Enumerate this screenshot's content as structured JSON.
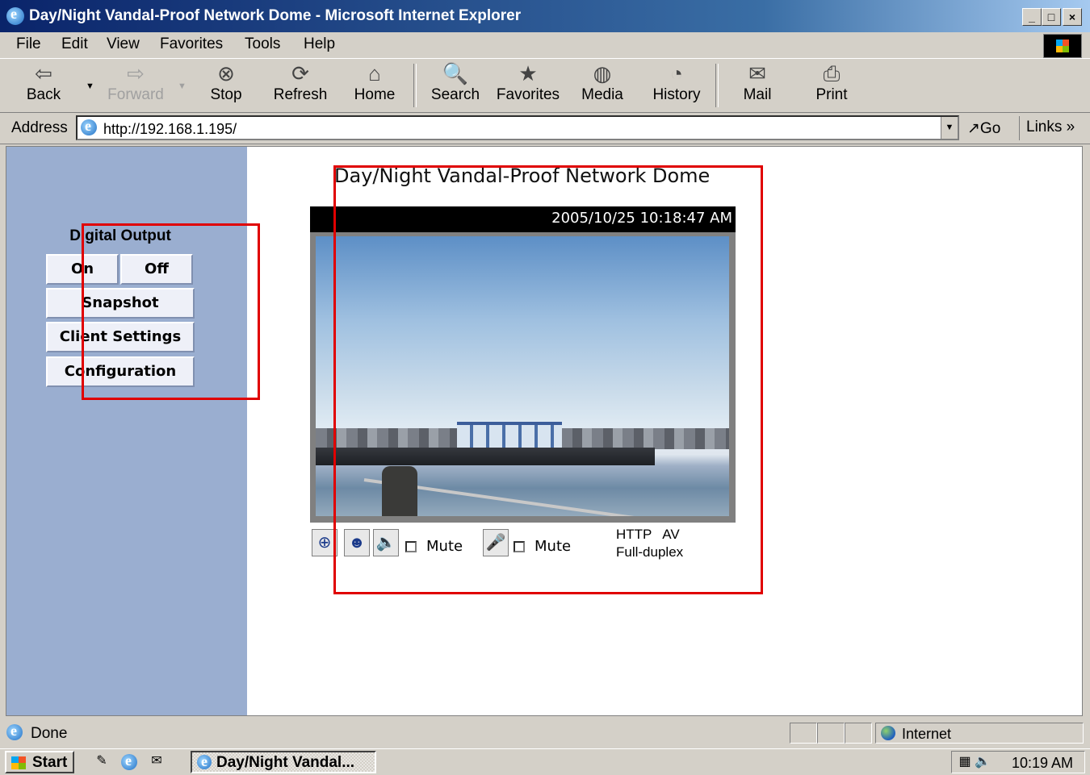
{
  "window": {
    "title": "Day/Night Vandal-Proof Network Dome - Microsoft Internet Explorer",
    "controls": {
      "minimize": "_",
      "maximize": "□",
      "close": "×"
    }
  },
  "menubar": {
    "items": [
      {
        "label": "File",
        "accel": "F"
      },
      {
        "label": "Edit",
        "accel": "E"
      },
      {
        "label": "View",
        "accel": "V"
      },
      {
        "label": "Favorites",
        "accel": "a"
      },
      {
        "label": "Tools",
        "accel": "T"
      },
      {
        "label": "Help",
        "accel": "H"
      }
    ]
  },
  "toolbar": {
    "back": "Back",
    "forward": "Forward",
    "stop": "Stop",
    "refresh": "Refresh",
    "home": "Home",
    "search": "Search",
    "favorites": "Favorites",
    "media": "Media",
    "history": "History",
    "mail": "Mail",
    "print": "Print"
  },
  "address": {
    "label": "Address",
    "url": "http://192.168.1.195/",
    "go": "Go",
    "links": "Links »"
  },
  "sidebar": {
    "digital_output_label": "Digital Output",
    "on": "On",
    "off": "Off",
    "snapshot": "Snapshot",
    "client_settings": "Client Settings",
    "configuration": "Configuration"
  },
  "main": {
    "title": "Day/Night Vandal-Proof Network Dome",
    "timestamp": "2005/10/25 10:18:47 AM",
    "mute1": "Mute",
    "mute2": "Mute",
    "protocol_line1": "HTTP   AV",
    "protocol_line2": "Full-duplex"
  },
  "statusbar": {
    "status": "Done",
    "zone": "Internet"
  },
  "taskbar": {
    "start": "Start",
    "task": "Day/Night Vandal...",
    "clock": "10:19 AM"
  },
  "colors": {
    "sidebar_bg": "#9aaed0",
    "annotation_red": "#e00000",
    "title_bar": "#0a246a"
  }
}
